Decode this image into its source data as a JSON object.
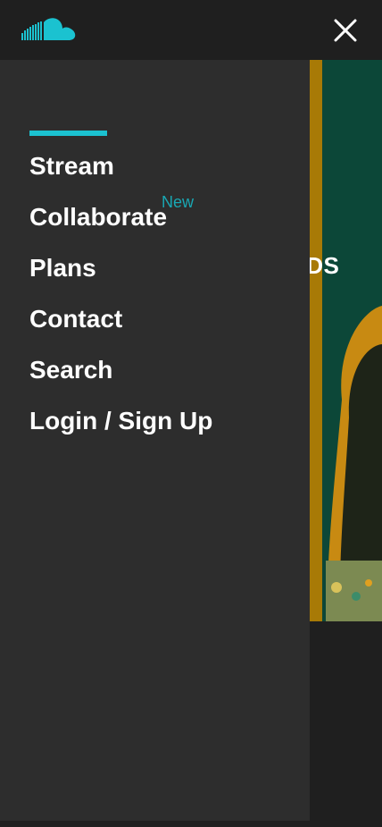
{
  "topbar": {
    "logo_icon": "soundcloud-cloud-icon",
    "close_icon": "close-icon",
    "accent_color": "#1bc2d0"
  },
  "hero": {
    "partial_headline": "NDS"
  },
  "drawer": {
    "items": [
      {
        "label": "Stream"
      },
      {
        "label": "Collaborate",
        "badge": "New"
      },
      {
        "label": "Plans"
      },
      {
        "label": "Contact"
      },
      {
        "label": "Search"
      },
      {
        "label": "Login / Sign Up"
      }
    ]
  }
}
